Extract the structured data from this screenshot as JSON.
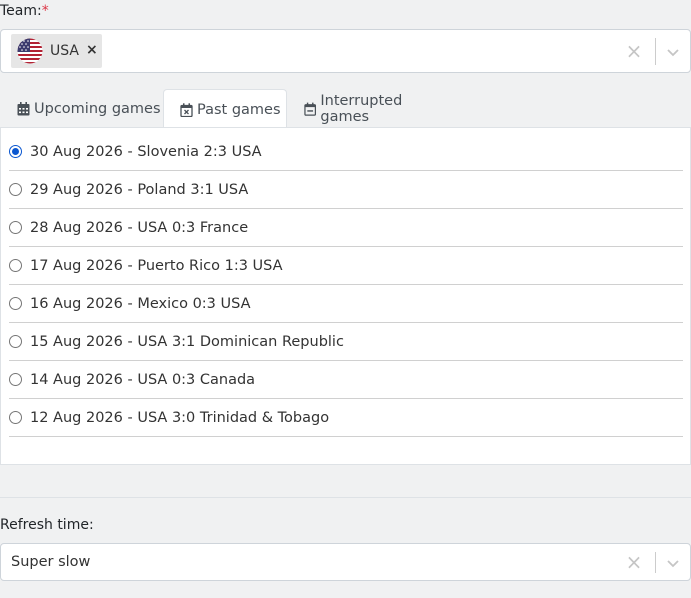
{
  "team": {
    "label": "Team:",
    "required_mark": "*",
    "selected": {
      "label": "USA",
      "flag": "us-flag-icon",
      "remove": "×"
    },
    "clear": "×"
  },
  "tabs": [
    {
      "label": "Upcoming games",
      "icon": "calendar-icon",
      "active": false
    },
    {
      "label": "Past games",
      "icon": "calendar-x-icon",
      "active": true
    },
    {
      "label": "Interrupted games",
      "icon": "calendar-minus-icon",
      "active": false
    }
  ],
  "games": [
    {
      "label": "30 Aug 2026 - Slovenia 2:3 USA",
      "checked": true
    },
    {
      "label": "29 Aug 2026 - Poland 3:1 USA",
      "checked": false
    },
    {
      "label": "28 Aug 2026 - USA 0:3 France",
      "checked": false
    },
    {
      "label": "17 Aug 2026 - Puerto Rico 1:3 USA",
      "checked": false
    },
    {
      "label": "16 Aug 2026 - Mexico 0:3 USA",
      "checked": false
    },
    {
      "label": "15 Aug 2026 - USA 3:1 Dominican Republic",
      "checked": false
    },
    {
      "label": "14 Aug 2026 - USA 0:3 Canada",
      "checked": false
    },
    {
      "label": "12 Aug 2026 - USA 3:0 Trinidad & Tobago",
      "checked": false
    }
  ],
  "refresh": {
    "label": "Refresh time:",
    "value": "Super slow",
    "clear": "×"
  },
  "colors": {
    "accent": "#0b57d0",
    "required": "#dc3545"
  }
}
